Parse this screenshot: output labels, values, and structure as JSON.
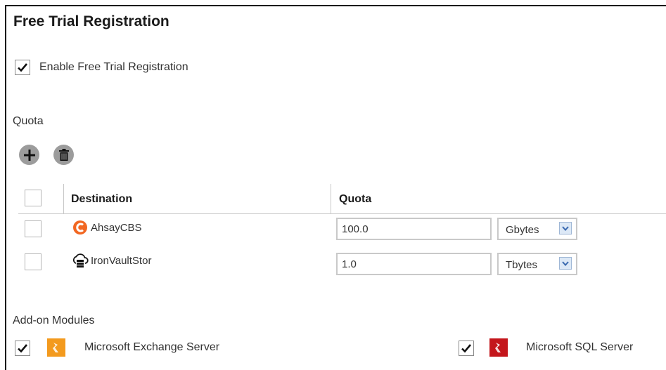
{
  "page": {
    "title": "Free Trial Registration",
    "enable_label": "Enable Free Trial Registration",
    "enable_checked": true
  },
  "quota": {
    "section_label": "Quota",
    "add_icon": "plus-icon",
    "delete_icon": "trash-icon",
    "table": {
      "headers": [
        "Destination",
        "Quota"
      ],
      "rows": [
        {
          "destination": "AhsayCBS",
          "icon": "ahsay-logo-icon",
          "quota": "100.0",
          "unit": "Gbytes",
          "checked": false
        },
        {
          "destination": "IronVaultStor",
          "icon": "cloud-storage-icon",
          "quota": "1.0",
          "unit": "Tbytes",
          "checked": false
        }
      ]
    }
  },
  "addons": {
    "section_label": "Add-on Modules",
    "modules": [
      {
        "name": "Microsoft Exchange Server",
        "icon": "exchange-module-icon",
        "color": "#f39a1e",
        "checked": true
      },
      {
        "name": "Microsoft SQL Server",
        "icon": "sql-module-icon",
        "color": "#c4161c",
        "checked": true
      }
    ]
  },
  "colors": {
    "ahsay": "#f26722",
    "button": "#9c9c9c",
    "dropdown": "#dce8f6"
  }
}
